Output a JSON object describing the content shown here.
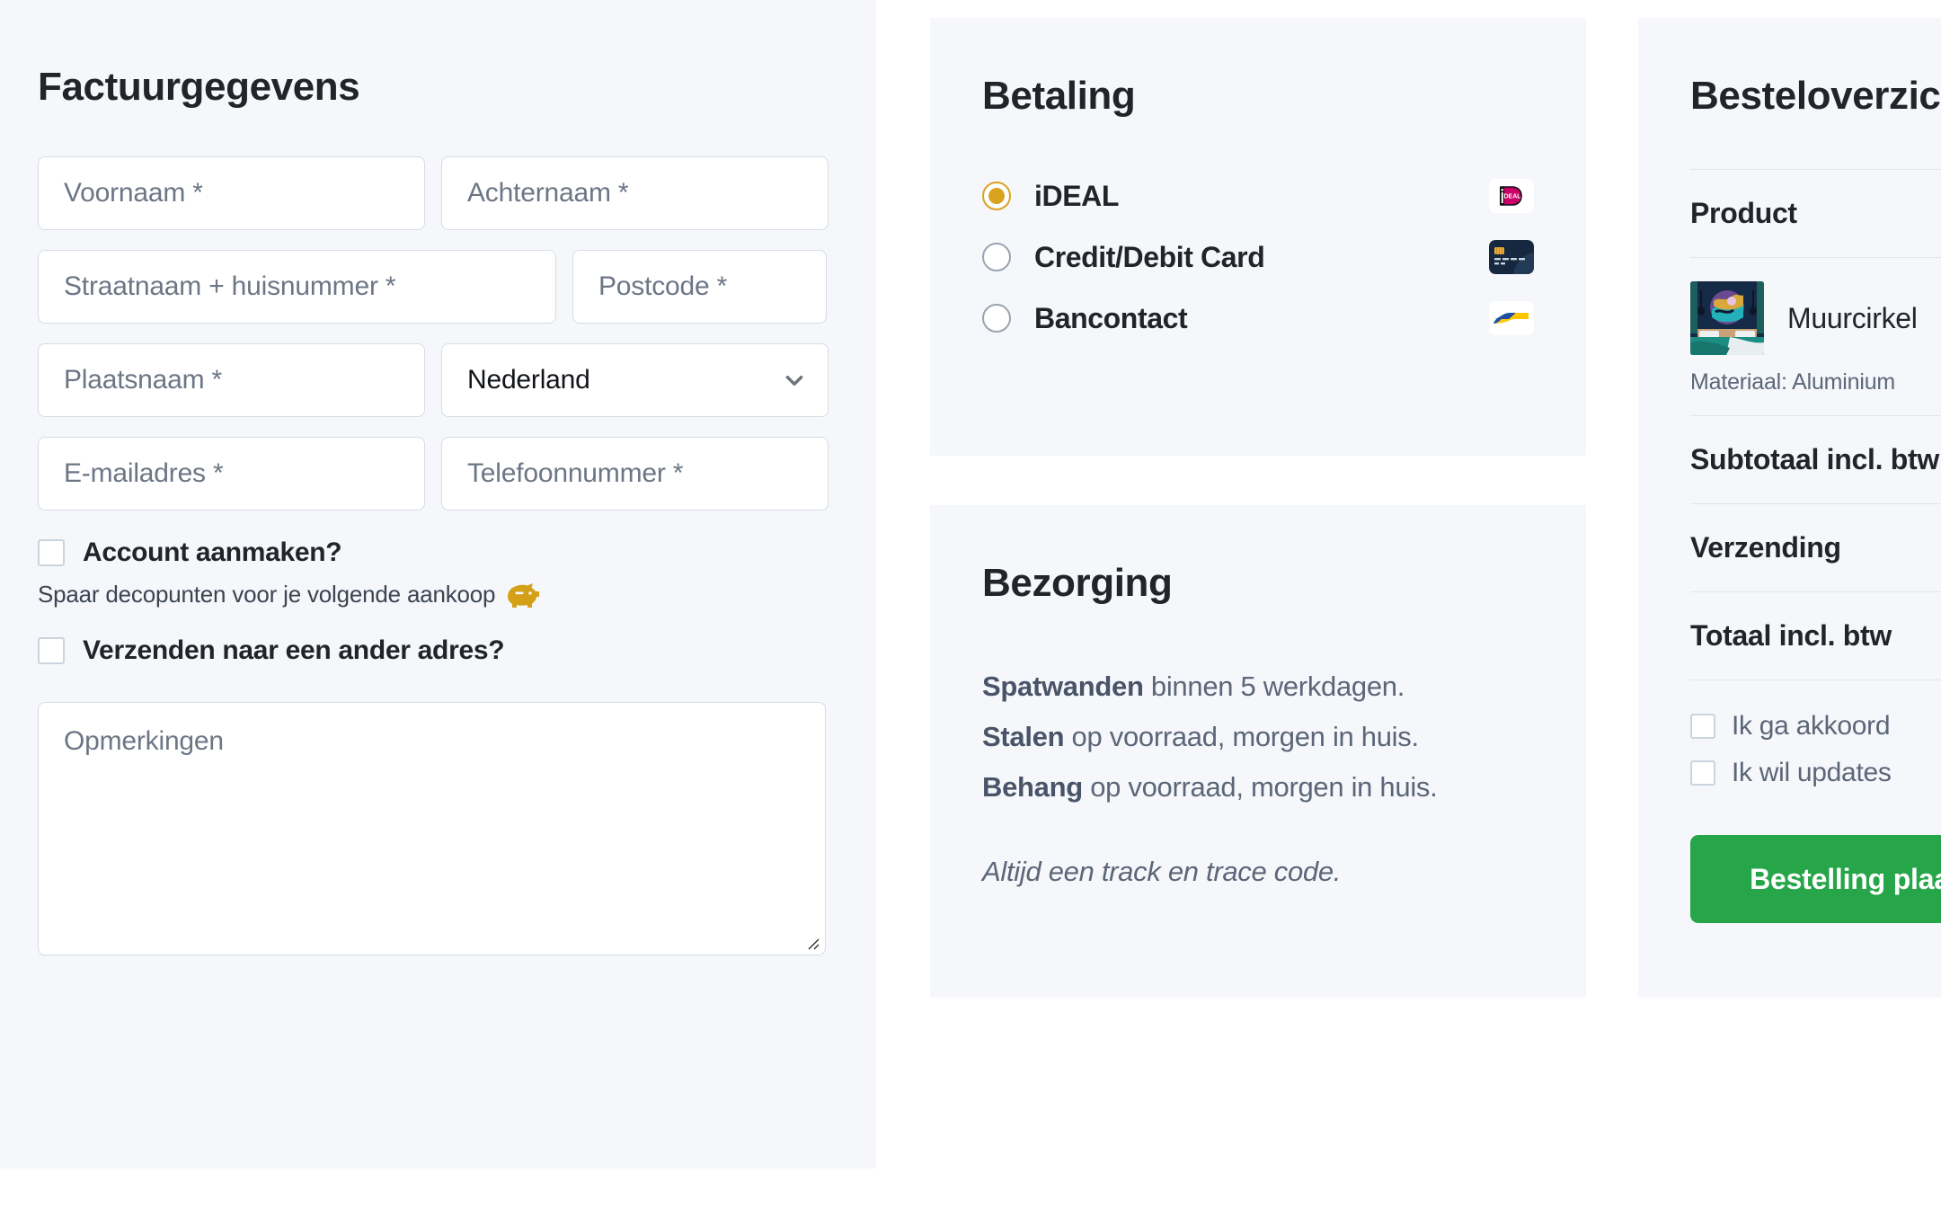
{
  "billing": {
    "title": "Factuurgegevens",
    "fields": {
      "first_name": "Voornaam *",
      "last_name": "Achternaam *",
      "street": "Straatnaam + huisnummer *",
      "postcode": "Postcode *",
      "city": "Plaatsnaam *",
      "country_value": "Nederland",
      "email": "E-mailadres *",
      "phone": "Telefoonnummer *",
      "comments": "Opmerkingen"
    },
    "create_account_label": "Account aanmaken?",
    "create_account_note": "Spaar decopunten voor je volgende aankoop",
    "ship_other_label": "Verzenden naar een ander adres?"
  },
  "payment": {
    "title": "Betaling",
    "options": [
      {
        "label": "iDEAL",
        "selected": true,
        "logo": "ideal-logo"
      },
      {
        "label": "Credit/Debit Card",
        "selected": false,
        "logo": "credit-card-logo"
      },
      {
        "label": "Bancontact",
        "selected": false,
        "logo": "bancontact-logo"
      }
    ]
  },
  "shipping": {
    "title": "Bezorging",
    "lines": [
      {
        "bold": "Spatwanden",
        "rest": " binnen 5 werkdagen."
      },
      {
        "bold": "Stalen",
        "rest": " op voorraad, morgen in huis."
      },
      {
        "bold": "Behang",
        "rest": " op voorraad, morgen in huis."
      }
    ],
    "note": "Altijd een track en trace code."
  },
  "summary": {
    "title": "Besteloverzicht",
    "product_header": "Product",
    "product_name": "Muurcirkel",
    "product_meta": "Materiaal: Aluminium",
    "rows": [
      "Subtotaal incl. btw",
      "Verzending",
      "Totaal incl. btw"
    ],
    "terms": [
      "Ik ga akkoord",
      "Ik wil updates"
    ],
    "place_order_label": "Bestelling plaatsen"
  },
  "colors": {
    "page_bg": "#ffffff",
    "panel_bg": "#f5f7fb",
    "accent_gold": "#d9a31f",
    "button_green": "#26a648",
    "ideal_pink": "#cc0066",
    "bancontact_blue": "#1e4fa0",
    "bancontact_yellow": "#ffc600",
    "text_dark": "#212529",
    "text_muted": "#5c6678",
    "border": "#d6dce3"
  }
}
